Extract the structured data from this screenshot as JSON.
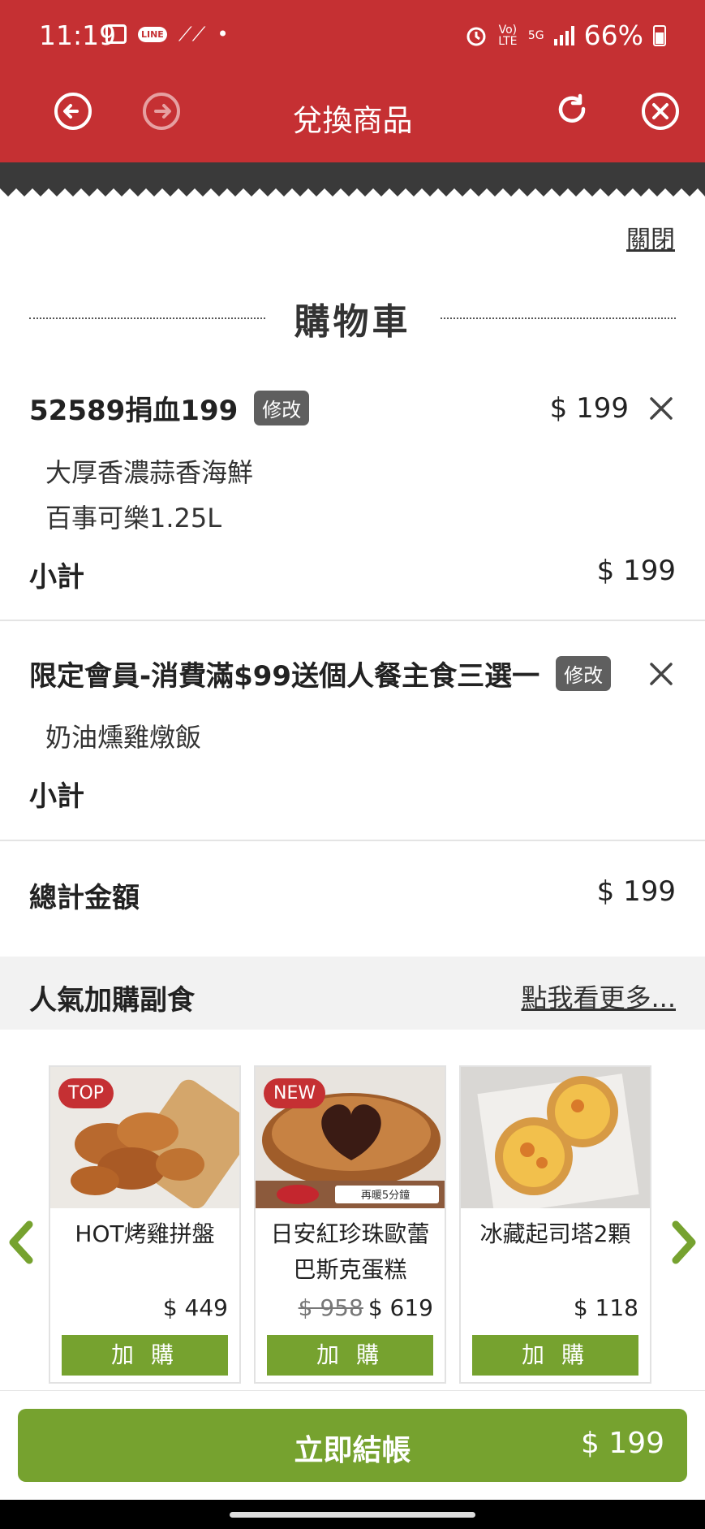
{
  "status_bar": {
    "time": "11:19",
    "battery": "66%",
    "network": "5G",
    "volte": "Vo) LTE",
    "dot": "•"
  },
  "nav": {
    "title": "兌換商品"
  },
  "close_label": "關閉",
  "cart": {
    "title": "購物車",
    "items": [
      {
        "name": "52589捐血199",
        "edit_label": "修改",
        "price": "$ 199",
        "options": [
          "大厚香濃蒜香海鮮",
          "百事可樂1.25L"
        ],
        "subtotal_label": "小計",
        "subtotal": "$ 199"
      },
      {
        "name": "限定會員-消費滿$99送個人餐主食三選一",
        "edit_label": "修改",
        "price": "",
        "options": [
          "奶油燻雞燉飯"
        ],
        "subtotal_label": "小計",
        "subtotal": ""
      }
    ],
    "total_label": "總計金額",
    "total": "$ 199"
  },
  "addons": {
    "title": "人氣加購副食",
    "more_link": "點我看更多...",
    "products": [
      {
        "tag": "TOP",
        "name": "HOT烤雞拼盤",
        "old_price": "",
        "price": "$ 449",
        "button": "加 購"
      },
      {
        "tag": "NEW",
        "name": "日安紅珍珠歐蕾巴斯克蛋糕",
        "old_price": "$ 958",
        "price": "$ 619",
        "button": "加 購"
      },
      {
        "tag": "",
        "name": "冰藏起司塔2顆",
        "old_price": "",
        "price": "$ 118",
        "button": "加 購"
      }
    ],
    "img_label_1": "再暖5分鐘"
  },
  "checkout": {
    "label": "立即結帳",
    "amount": "$ 199"
  },
  "colors": {
    "brand_red": "#c53033",
    "action_green": "#76a22f"
  }
}
